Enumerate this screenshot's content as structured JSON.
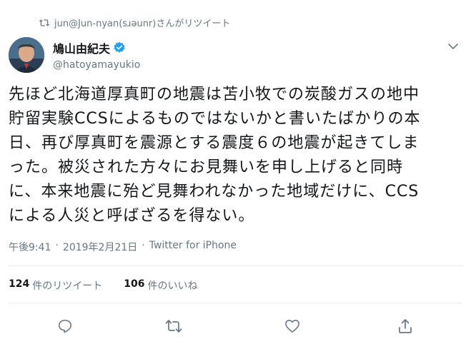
{
  "retweet_context": {
    "text": "jun@Jun-nyan(sɹəunr)さんがリツイート",
    "icon": "retweet-icon"
  },
  "author": {
    "display_name": "鳩山由紀夫",
    "screen_name": "@hatoyamayukio",
    "verified": true,
    "verified_color": "#1da1f2"
  },
  "tweet": {
    "text": "先ほど北海道厚真町の地震は苫小牧での炭酸ガスの地中\n貯留実験CCSによるものではないかと書いたばかりの本\n日、再び厚真町を震源とする震度６の地震が起きてしま\nった。被災された方々にお見舞いを申し上げると同時\nに、本来地震に殆ど見舞われなかった地域だけに、CCS\nによる人災と呼ばざるを得ない。"
  },
  "metadata": {
    "time": "午後9:41",
    "separator1": "·",
    "date": "2019年2月21日",
    "separator2": "·",
    "source": "Twitter for iPhone"
  },
  "stats": {
    "retweets_count": "124",
    "retweets_label": "件のリツイート",
    "likes_count": "106",
    "likes_label": "件のいいね"
  },
  "actions": [
    "reply-icon",
    "retweet-icon",
    "like-icon",
    "share-icon"
  ],
  "colors": {
    "secondary_text": "#657786",
    "icon_gray": "#657786",
    "divider": "#e6ecf0"
  }
}
